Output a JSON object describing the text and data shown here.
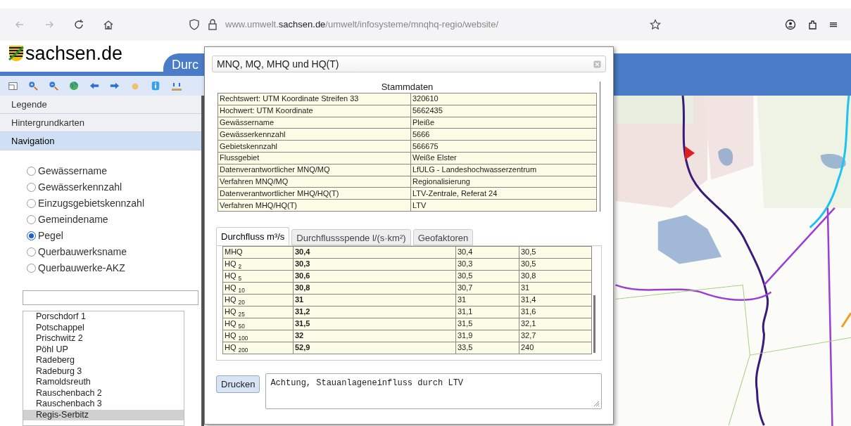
{
  "browser": {
    "url": "www.umwelt.**sachsen.de**/umwelt/infosysteme/mnqhq-regio/website/"
  },
  "header": {
    "logo": "sachsen.de",
    "tab": "Durc"
  },
  "sidebar": {
    "sections": [
      {
        "label": "Legende",
        "selected": false
      },
      {
        "label": "Hintergrundkarten",
        "selected": false
      },
      {
        "label": "Navigation",
        "selected": true
      }
    ],
    "options": [
      {
        "label": "Gewässername",
        "selected": false
      },
      {
        "label": "Gewässerkennzahl",
        "selected": false
      },
      {
        "label": "Einzugsgebietskennzahl",
        "selected": false
      },
      {
        "label": "Gemeindename",
        "selected": false
      },
      {
        "label": "Pegel",
        "selected": true
      },
      {
        "label": "Querbauwerksname",
        "selected": false
      },
      {
        "label": "Querbauwerke-AKZ",
        "selected": false
      }
    ],
    "list": [
      {
        "label": "Porschdorf 1",
        "selected": false
      },
      {
        "label": "Potschappel",
        "selected": false
      },
      {
        "label": "Prischwitz 2",
        "selected": false
      },
      {
        "label": "Pöhl UP",
        "selected": false
      },
      {
        "label": "Radeberg",
        "selected": false
      },
      {
        "label": "Radeburg 3",
        "selected": false
      },
      {
        "label": "Ramoldsreuth",
        "selected": false
      },
      {
        "label": "Rauschenbach 2",
        "selected": false
      },
      {
        "label": "Rauschenbach 3",
        "selected": false
      },
      {
        "label": "Regis-Serbitz",
        "selected": true
      }
    ]
  },
  "dialog": {
    "title": "MNQ, MQ, MHQ und HQ(T)",
    "stammdaten": {
      "title": "Stammdaten",
      "rows": [
        [
          "Rechtswert: UTM Koordinate Streifen 33",
          "320610"
        ],
        [
          "Hochwert: UTM Koordinate",
          "5662435"
        ],
        [
          "Gewässername",
          "Pleiße"
        ],
        [
          "Gewässerkennzahl",
          "5666"
        ],
        [
          "Gebietskennzahl",
          "566675"
        ],
        [
          "Flussgebiet",
          "Weiße Elster"
        ],
        [
          "Datenverantwortlicher MNQ/MQ",
          "LfULG - Landeshochwasserzentrum"
        ],
        [
          "Verfahren MNQ/MQ",
          "Regionalisierung"
        ],
        [
          "Datenverantwortlicher MHQ/HQ(T)",
          "LTV-Zentrale, Referat 24"
        ],
        [
          "Verfahren MHQ/HQ(T)",
          "LTV"
        ]
      ]
    },
    "tabs": [
      {
        "label": "Durchfluss m³/s",
        "selected": true
      },
      {
        "label": "Durchflussspende l/(s·km²)",
        "selected": false
      },
      {
        "label": "Geofaktoren",
        "selected": false
      }
    ],
    "rows": [
      [
        "MHQ",
        "30,4",
        "30,4",
        "30,5"
      ],
      [
        "HQ $_{2}$",
        "30,3",
        "30,3",
        "30,5"
      ],
      [
        "HQ $_{5}$",
        "30,6",
        "30,5",
        "30,8"
      ],
      [
        "HQ $_{10}$",
        "30,8",
        "30,7",
        "31"
      ],
      [
        "HQ $_{20}$",
        "31",
        "31",
        "31,4"
      ],
      [
        "HQ $_{25}$",
        "31,2",
        "31,1",
        "31,6"
      ],
      [
        "HQ $_{50}$",
        "31,5",
        "31,5",
        "32,1"
      ],
      [
        "HQ $_{100}$",
        "32",
        "31,9",
        "32,7"
      ],
      [
        "HQ $_{200}$",
        "52,9",
        "33,5",
        "240"
      ]
    ],
    "print_button": "Drucken",
    "note": "Achtung, Stauanlageneinfluss durch LTV"
  }
}
